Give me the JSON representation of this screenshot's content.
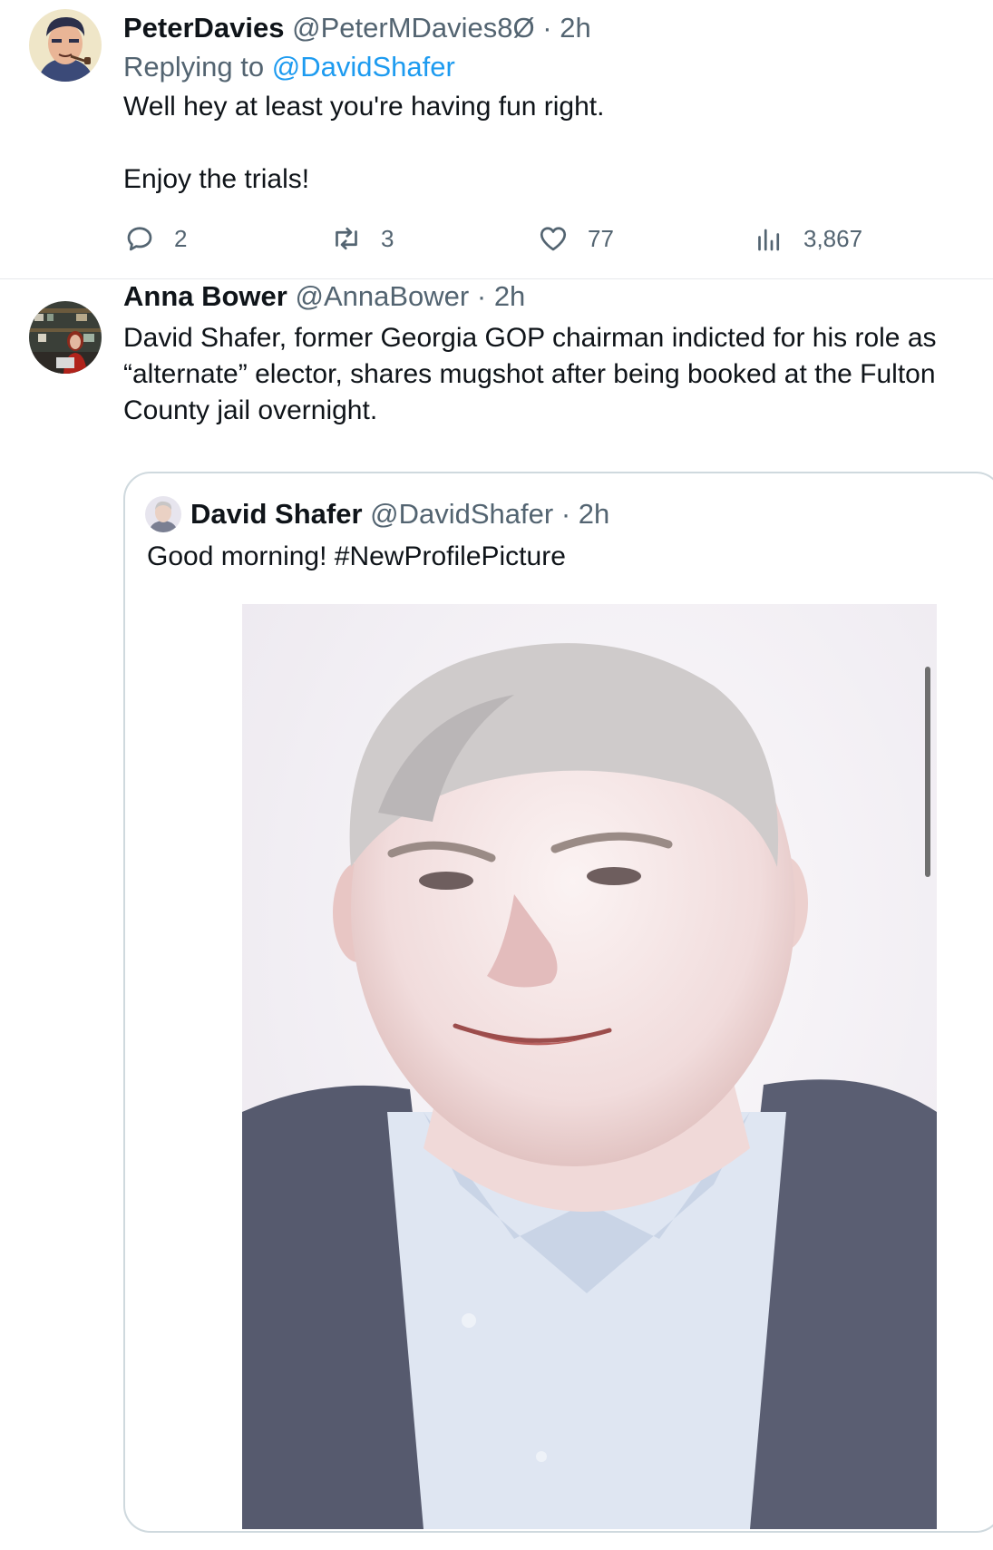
{
  "reply": {
    "display_name": "PeterDavies",
    "handle": "@PeterMDavies8Ø",
    "separator": "·",
    "time": "2h",
    "replying_prefix": "Replying to",
    "replying_to": "@DavidShafer",
    "text_line1": "Well hey at least you're having fun right.",
    "text_line2": "Enjoy the trials!",
    "avatar_icon": "cartoon-man-pipe-avatar",
    "stats": {
      "replies": "2",
      "retweets": "3",
      "likes": "77",
      "views": "3,867"
    }
  },
  "tweet": {
    "display_name": "Anna Bower",
    "handle": "@AnnaBower",
    "separator": "·",
    "time": "2h",
    "text_line1": "David Shafer, former Georgia GOP chairman indicted for his role as",
    "text_line2": "“alternate” elector, shares mugshot after being booked at the Fulton",
    "text_line3": "County jail overnight.",
    "avatar_icon": "woman-red-hair-avatar"
  },
  "quoted_tweet": {
    "display_name": "David Shafer",
    "handle": "@DavidShafer",
    "separator": "·",
    "time": "2h",
    "text": "Good morning! #NewProfilePicture",
    "avatar_icon": "man-portrait-avatar",
    "media": "mugshot-photo"
  },
  "colors": {
    "link": "#1d9bf0",
    "muted": "#536471",
    "text": "#0f1419",
    "border": "#cfd9de"
  }
}
